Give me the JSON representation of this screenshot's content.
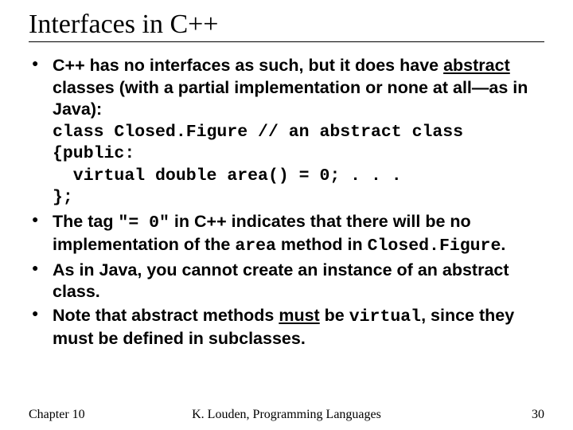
{
  "title": "Interfaces in C++",
  "bullets": [
    {
      "intro_a": "C++ has no interfaces as such, but it does have ",
      "under1": "abstract",
      "intro_b": " classes (with a partial implementation or none at all—as in Java):",
      "code": "class Closed.Figure // an abstract class\n{public:\n  virtual double area() = 0; . . .\n};"
    },
    {
      "t1": "The tag ",
      "c1": "\"= 0\"",
      "t2": " in C++ indicates that there will be no implementation of the ",
      "c2": "area",
      "t3": " method in ",
      "c3": "Closed.Figure",
      "t4": "."
    },
    {
      "text": "As in Java, you cannot create an instance of an abstract class."
    },
    {
      "t1": "Note that abstract methods ",
      "under1": "must",
      "t2": " be ",
      "c1": "virtual",
      "t3": ", since they must be defined in subclasses."
    }
  ],
  "footer": {
    "left": "Chapter 10",
    "center": "K. Louden, Programming Languages",
    "right": "30"
  }
}
